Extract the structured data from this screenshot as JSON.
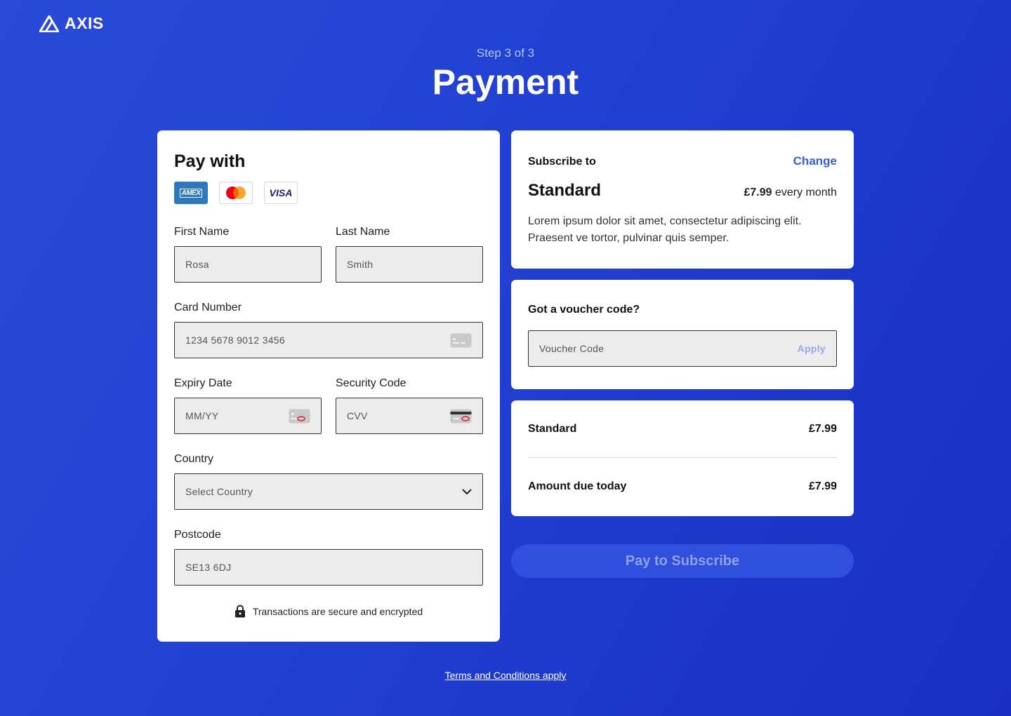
{
  "header": {
    "logo_text": "AXIS",
    "step": "Step 3 of 3",
    "title": "Payment"
  },
  "pay_form": {
    "title": "Pay with",
    "brands": [
      "AMEX",
      "VISA"
    ],
    "first_name": {
      "label": "First Name",
      "placeholder": "Rosa"
    },
    "last_name": {
      "label": "Last Name",
      "placeholder": "Smith"
    },
    "card_number": {
      "label": "Card Number",
      "placeholder": "1234 5678 9012 3456"
    },
    "expiry": {
      "label": "Expiry Date",
      "placeholder": "MM/YY"
    },
    "security": {
      "label": "Security Code",
      "placeholder": "CVV"
    },
    "country": {
      "label": "Country",
      "selected": "Select Country"
    },
    "postcode": {
      "label": "Postcode",
      "placeholder": "SE13 6DJ"
    },
    "secure_note": "Transactions are secure and encrypted"
  },
  "subscription": {
    "label": "Subscribe to",
    "change": "Change",
    "plan": "Standard",
    "price": "£7.99",
    "period": "every month",
    "description_1": "Lorem ipsum dolor sit amet, consectetur adipiscing elit.",
    "description_2": "Praesent ve tortor, pulvinar quis semper."
  },
  "voucher": {
    "question": "Got a voucher code?",
    "placeholder": "Voucher Code",
    "apply": "Apply"
  },
  "totals": {
    "line_label": "Standard",
    "line_value": "£7.99",
    "due_label": "Amount due today",
    "due_value": "£7.99"
  },
  "pay_button": "Pay to Subscribe",
  "terms": "Terms and Conditions apply",
  "colors": {
    "background": "#2140d2",
    "accent": "#3b5bdb",
    "button": "#2f4fdc"
  }
}
